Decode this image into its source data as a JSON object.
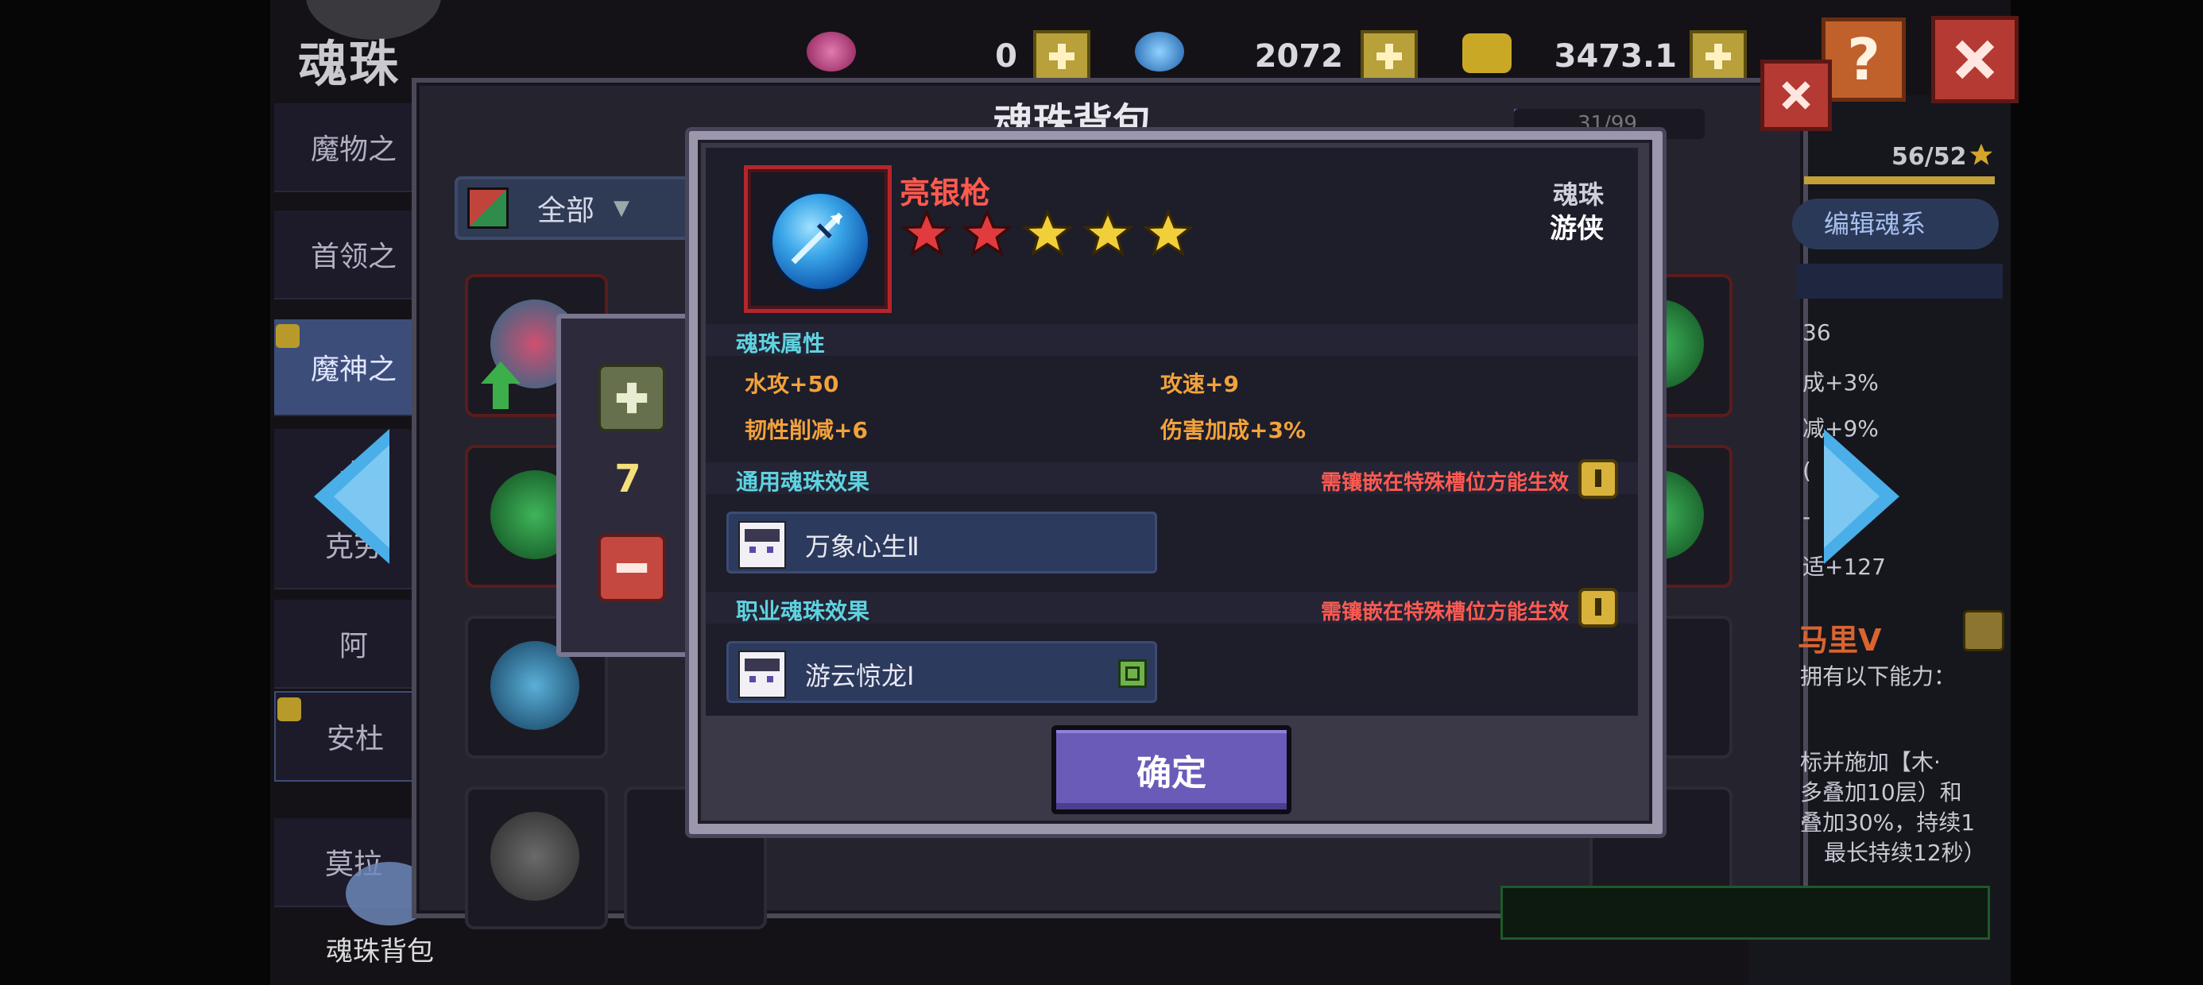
{
  "background": {
    "title": "魂珠",
    "bag_title": "魂珠背包",
    "bag_count": "31/99",
    "currencies": [
      {
        "icon": "pink-gem-icon",
        "value": "0",
        "color": "#b73b7a"
      },
      {
        "icon": "blue-diamond-icon",
        "value": "2072",
        "color": "#3c8ed6"
      },
      {
        "icon": "gold-coin-icon",
        "value": "3473.1万",
        "color": "#c9a826"
      }
    ],
    "help_label": "?",
    "sidebar": [
      {
        "label": "魔物之",
        "badge": false
      },
      {
        "label": "首领之",
        "badge": false
      },
      {
        "label": "魔神之",
        "badge": true,
        "active": true
      },
      {
        "label": "卡",
        "badge": false
      },
      {
        "label": "克劳",
        "badge": false
      },
      {
        "label": "阿",
        "badge": false
      },
      {
        "label": "安杜",
        "badge": true
      },
      {
        "label": "莫拉",
        "badge": false
      }
    ],
    "bag_label": "魂珠背包",
    "filter_label": "全部",
    "quantity": "7",
    "right_panel": {
      "level": "56/52",
      "edit_button": "编辑魂系",
      "stats": [
        "36",
        "成+3%",
        "减+9%",
        "(",
        "-",
        "适+127"
      ],
      "skill_title": "马里V",
      "skill_desc": [
        "拥有以下能力：",
        "",
        "标并施加【木·",
        "多叠加10层）和",
        "叠加30%，持续1",
        "最长持续12秒）"
      ]
    }
  },
  "dialog": {
    "item_name": "亮银枪",
    "item_type": "魂珠",
    "item_class": "游侠",
    "stars": {
      "filled_red": 2,
      "filled_gold": 3,
      "total": 5
    },
    "colors": {
      "red_star": "#e23b3f",
      "gold_star": "#f1cf3a",
      "name": "#ff5a4e",
      "stat": "#f2a23b",
      "section": "#5fd2e0",
      "warn": "#ff5a52"
    },
    "attributes_title": "魂珠属性",
    "attributes": [
      "水攻+50",
      "攻速+9",
      "韧性削减+6",
      "伤害加成+3%"
    ],
    "general_effect_title": "通用魂珠效果",
    "general_effect_warning": "需镶嵌在特殊槽位方能生效",
    "general_effect_name": "万象心生Ⅱ",
    "class_effect_title": "职业魂珠效果",
    "class_effect_warning": "需镶嵌在特殊槽位方能生效",
    "class_effect_name": "游云惊龙Ⅰ",
    "confirm_label": "确定"
  }
}
